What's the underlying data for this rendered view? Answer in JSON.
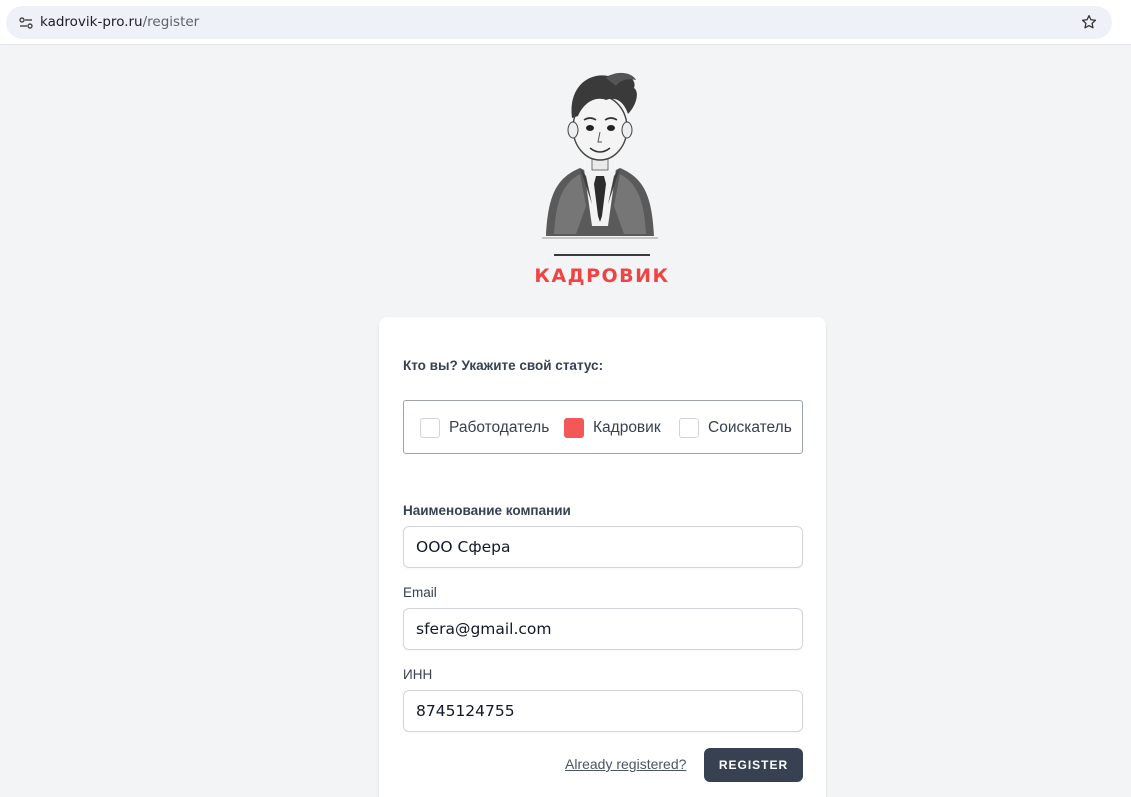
{
  "browser": {
    "url_host": "kadrovik-pro.ru",
    "url_path": "/register"
  },
  "logo": {
    "brand_text": "КАДРОВИК",
    "brand_color": "#ef4444"
  },
  "form": {
    "status_heading": "Кто вы? Укажите свой статус:",
    "status_options": [
      {
        "label": "Работодатель",
        "checked": false
      },
      {
        "label": "Кадровик",
        "checked": true
      },
      {
        "label": "Соискатель",
        "checked": false
      }
    ],
    "company_label": "Наименование компании",
    "company_value": "ООО Сфера",
    "email_label": "Email",
    "email_value": "sfera@gmail.com",
    "inn_label": "ИНН",
    "inn_value": "8745124755",
    "already_registered_link": "Already registered?",
    "register_button": "REGISTER"
  },
  "colors": {
    "accent": "#f35757",
    "button_bg": "#374151",
    "page_bg": "#f3f4f6"
  },
  "icons": [
    "site-info-icon",
    "star-icon",
    "avatar-illustration"
  ]
}
